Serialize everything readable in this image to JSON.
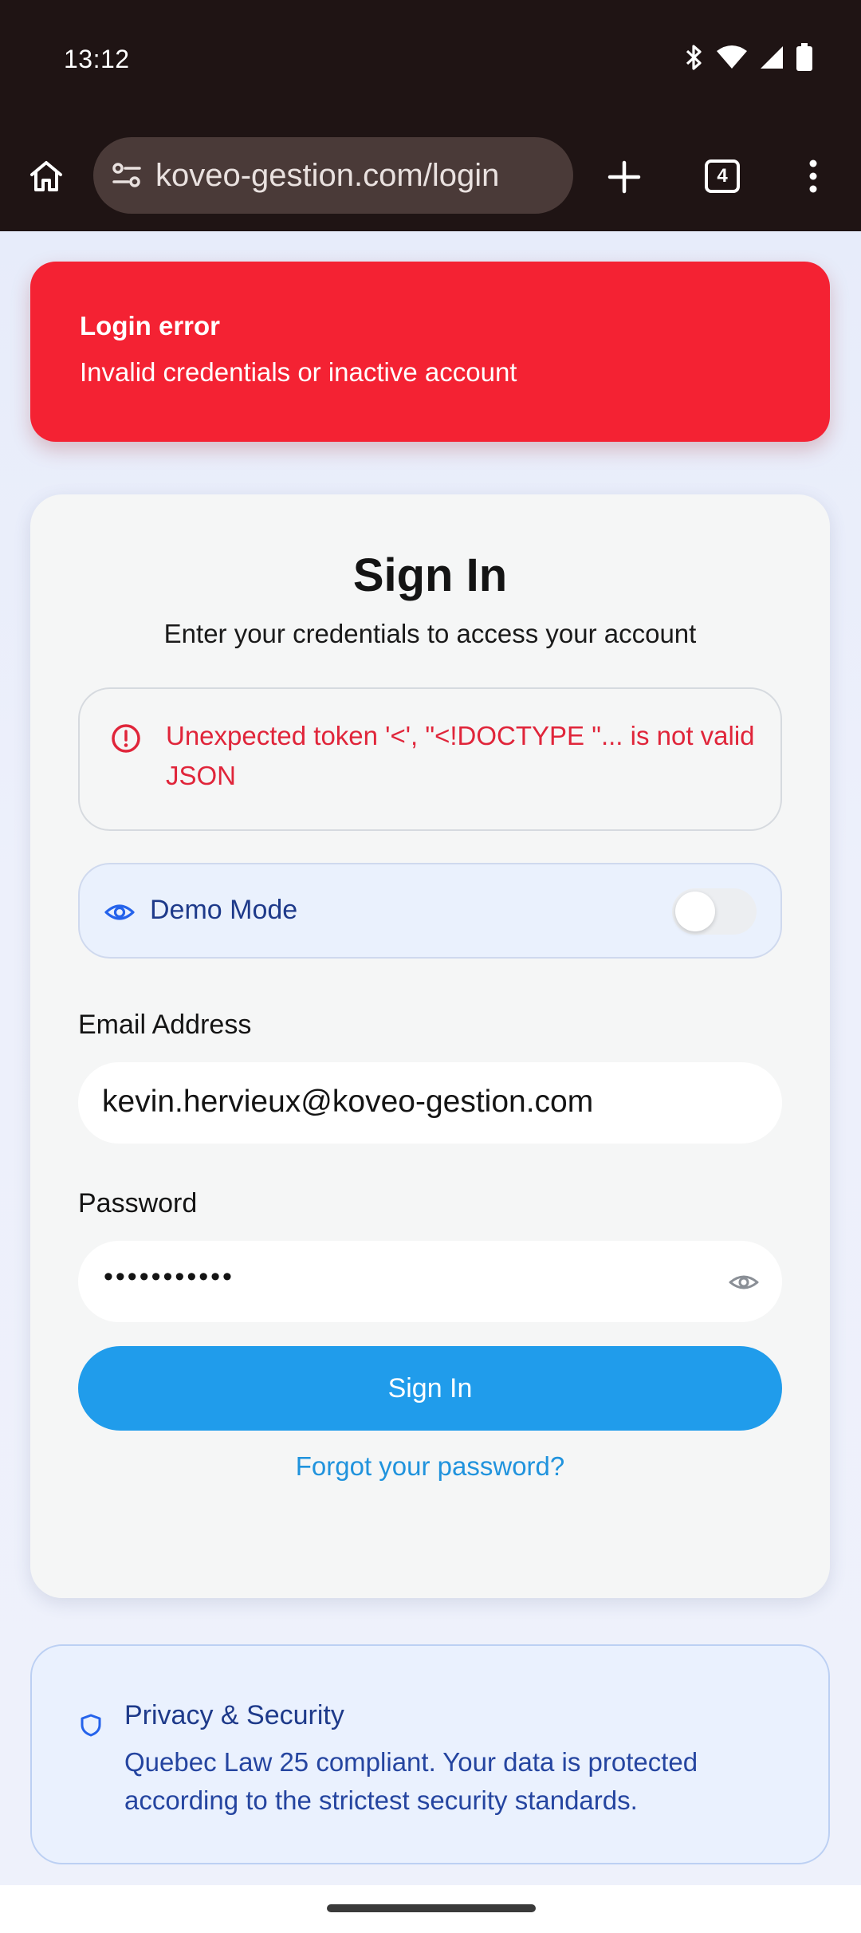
{
  "status_bar": {
    "time": "13:12",
    "icons": [
      "bluetooth-icon",
      "wifi-icon",
      "cell-signal-icon",
      "battery-icon"
    ]
  },
  "browser": {
    "url": "koveo-gestion.com/login",
    "tab_count": "4"
  },
  "toast": {
    "title": "Login error",
    "description": "Invalid credentials or inactive account",
    "color": "#f42233"
  },
  "login_card": {
    "title": "Sign In",
    "subtitle": "Enter your credentials to access your account",
    "error_message": "Unexpected token '<', \"<!DOCTYPE \"... is not valid JSON",
    "demo_mode": {
      "label": "Demo Mode",
      "enabled": false
    },
    "email": {
      "label": "Email Address",
      "value": "kevin.hervieux@koveo-gestion.com"
    },
    "password": {
      "label": "Password",
      "masked_value": "•••••••••••"
    },
    "submit_label": "Sign In",
    "forgot_label": "Forgot your password?"
  },
  "privacy": {
    "title": "Privacy & Security",
    "text": "Quebec Law 25 compliant. Your data is protected according to the strictest security standards."
  },
  "colors": {
    "primary_button": "#209ceb",
    "link": "#2093dd",
    "error_text": "#e0253a",
    "info_text": "#1e3a8a"
  }
}
